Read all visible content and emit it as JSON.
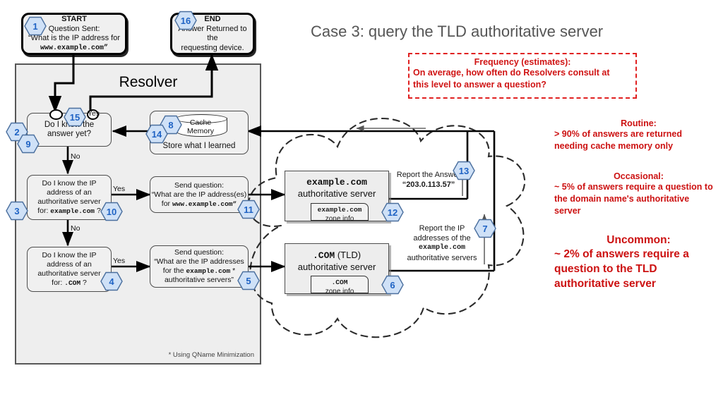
{
  "title": "Case 3: query the TLD authoritative server",
  "resolver": {
    "title": "Resolver",
    "footnote": "* Using QName Minimization"
  },
  "nodes": {
    "start": {
      "heading": "START",
      "line1": "Question Sent:",
      "line2": "“What is the IP address for",
      "line3": "www.example.com”",
      "badge": "1"
    },
    "end": {
      "heading": "END",
      "line1": "Answer Returned to the",
      "line2": "requesting device.",
      "badge": "16"
    },
    "know_answer": {
      "line1": "Do I know the",
      "line2": "answer yet?",
      "badges": [
        "2",
        "9",
        "15"
      ],
      "yes_label": "Yes",
      "no_label": "No"
    },
    "cache": {
      "db_line1": "Cache",
      "db_line2": "Memory",
      "caption": "Store what I learned",
      "badges": [
        "8",
        "14"
      ]
    },
    "know_ip_example": {
      "line1": "Do I know the IP",
      "line2": "address of an",
      "line3": "authoritative server",
      "line4_plain": "for:",
      "line4_mono": "example.com",
      "line4_tail": "?",
      "badges": [
        "3",
        "10"
      ],
      "yes_label": "Yes",
      "no_label": "No"
    },
    "send_q_example": {
      "line1": "Send question:",
      "line2": "“What are the IP address(es)",
      "line3_plain": "for",
      "line3_mono": "www.example.com”",
      "badge": "11"
    },
    "know_ip_com": {
      "line1": "Do I know the IP",
      "line2": "address of an",
      "line3": "authoritative server",
      "line4_plain": "for:",
      "line4_mono": ".COM",
      "line4_tail": "?",
      "badge": "4",
      "yes_label": "Yes"
    },
    "send_q_com": {
      "line1": "Send question:",
      "line2": "“What are the IP addresses",
      "line3_plain": "for the",
      "line3_mono": "example.com",
      "line3_tail": "*",
      "line4": "authoritative servers”",
      "badge": "5"
    },
    "example_server": {
      "name": "example.com",
      "subtitle": "authoritative server",
      "zone_line1": "example.com",
      "zone_line2": "zone info",
      "badge": "12"
    },
    "com_server": {
      "name": ".COM",
      "name_tail": "(TLD)",
      "subtitle": "authoritative server",
      "zone_line1": ".COM",
      "zone_line2": "zone info",
      "badge": "6"
    }
  },
  "edge_labels": {
    "report_answer_line1": "Report the Answer",
    "report_answer_line2": "“203.0.113.57”",
    "report_answer_badge": "13",
    "report_ip_line1": "Report the IP",
    "report_ip_line2": "addresses of the",
    "report_ip_line3_mono": "example.com",
    "report_ip_line4": "authoritative servers",
    "report_ip_badge": "7"
  },
  "frequency_box": {
    "title": "Frequency (estimates):",
    "line1": "On average, how often do Resolvers consult at",
    "line2": "this level to answer a question?"
  },
  "stats": [
    {
      "heading": "Routine:",
      "lines": [
        "> 90% of answers are returned",
        "needing cache memory only"
      ]
    },
    {
      "heading": "Occasional:",
      "lines": [
        "~ 5% of answers require a question to",
        "the domain name's authoritative",
        "server"
      ]
    },
    {
      "heading": "Uncommon:",
      "lines": [
        "~ 2% of answers require a",
        "question to the TLD",
        "authoritative server"
      ]
    }
  ],
  "colors": {
    "accent_red": "#cc1111",
    "hex_fill": "#cfe1f7",
    "hex_text": "#1f63c4",
    "resolver_bg": "#eeeeee",
    "title_gray": "#555555"
  }
}
